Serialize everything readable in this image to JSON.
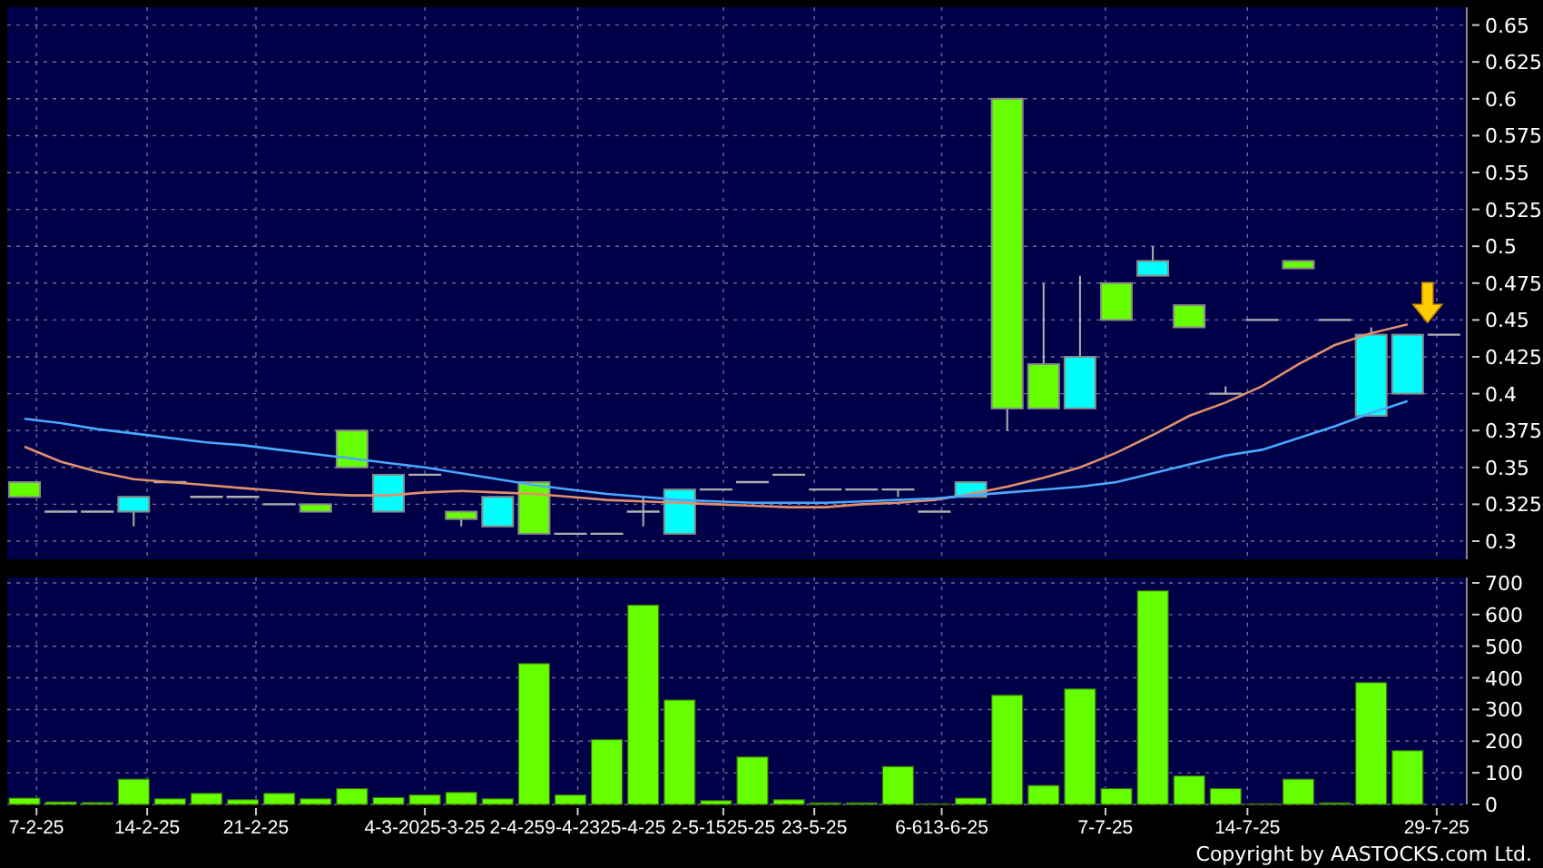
{
  "price_chart": {
    "chart_data": {
      "type": "line",
      "grid": true,
      "ylim": [
        0.3,
        0.65
      ],
      "yticks": [
        0.3,
        0.325,
        0.35,
        0.375,
        0.4,
        0.425,
        0.45,
        0.475,
        0.5,
        0.525,
        0.55,
        0.575,
        0.6,
        0.625,
        0.65
      ],
      "series": [
        {
          "color": "#e0906a",
          "values": [
            0.364,
            0.354,
            0.347,
            0.342,
            0.34,
            0.338,
            0.336,
            0.334,
            0.332,
            0.331,
            0.331,
            0.333,
            0.334,
            0.333,
            0.332,
            0.33,
            0.328,
            0.327,
            0.326,
            0.325,
            0.324,
            0.323,
            0.323,
            0.325,
            0.326,
            0.328,
            0.332,
            0.337,
            0.343,
            0.35,
            0.36,
            0.372,
            0.385,
            0.394,
            0.405,
            0.42,
            0.433,
            0.441,
            0.447,
            null
          ]
        },
        {
          "color": "#4aa8ff",
          "values": [
            0.383,
            0.38,
            0.376,
            0.373,
            0.37,
            0.367,
            0.365,
            0.362,
            0.359,
            0.356,
            0.353,
            0.35,
            0.346,
            0.342,
            0.338,
            0.335,
            0.332,
            0.33,
            0.328,
            0.327,
            0.326,
            0.326,
            0.326,
            0.327,
            0.328,
            0.329,
            0.331,
            0.333,
            0.335,
            0.337,
            0.34,
            0.346,
            0.352,
            0.358,
            0.362,
            0.37,
            0.378,
            0.387,
            0.395,
            null
          ]
        }
      ]
    }
  },
  "volume_chart": {
    "chart_data": {
      "type": "bar",
      "grid": true,
      "color": "#66ff00",
      "ylim": [
        0,
        700
      ],
      "yticks": [
        0,
        100,
        200,
        300,
        400,
        500,
        600,
        700
      ],
      "values": [
        20,
        8,
        6,
        80,
        18,
        35,
        15,
        35,
        18,
        50,
        22,
        30,
        38,
        18,
        445,
        30,
        205,
        630,
        330,
        12,
        150,
        15,
        5,
        5,
        120,
        2,
        20,
        345,
        60,
        365,
        50,
        675,
        90,
        50,
        2,
        80,
        5,
        385,
        170,
        0
      ]
    },
    "date_labels": [
      "7-2-25",
      "14-2-25",
      "21-2-25",
      "4-3-2025-3-25",
      "2-4-259-4-2325-4-25",
      "2-5-1525-25",
      "23-5-25",
      "6-613-6-25",
      "7-7-25",
      "14-7-25",
      "29-7-25"
    ]
  },
  "copyright": "Copyright by AASTOCKS.com Ltd."
}
